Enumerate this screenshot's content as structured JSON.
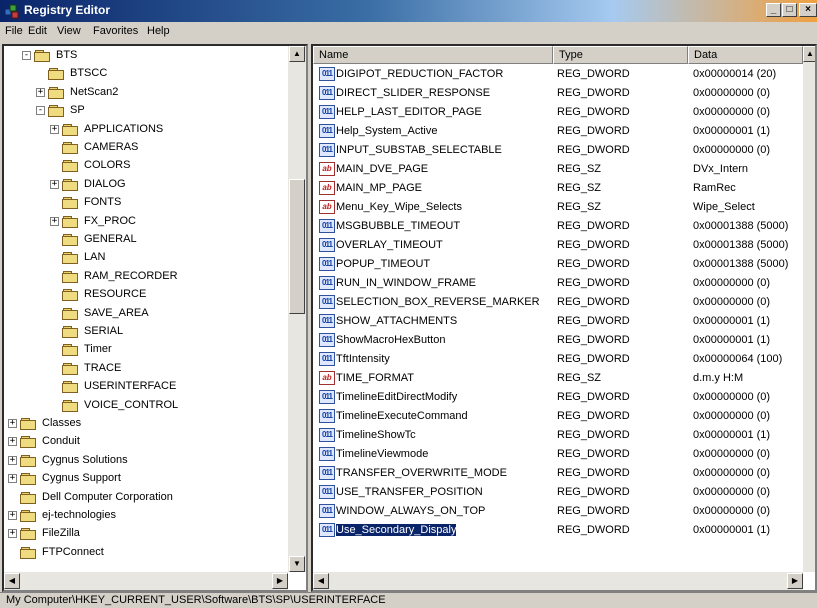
{
  "window": {
    "title": "Registry Editor",
    "minimize": "_",
    "maximize": "□",
    "close": "×",
    "colors": {
      "title_start": "#0a246a",
      "selection": "#0a246a",
      "face": "#d4d0c8"
    }
  },
  "menu": [
    "File",
    "Edit",
    "View",
    "Favorites",
    "Help"
  ],
  "tree": [
    {
      "label": "BTS",
      "level": 1,
      "expander": "-",
      "open": true
    },
    {
      "label": "BTSCC",
      "level": 2,
      "expander": ""
    },
    {
      "label": "NetScan2",
      "level": 2,
      "expander": "+"
    },
    {
      "label": "SP",
      "level": 2,
      "expander": "-",
      "open": true
    },
    {
      "label": "APPLICATIONS",
      "level": 3,
      "expander": "+"
    },
    {
      "label": "CAMERAS",
      "level": 3,
      "expander": ""
    },
    {
      "label": "COLORS",
      "level": 3,
      "expander": ""
    },
    {
      "label": "DIALOG",
      "level": 3,
      "expander": "+"
    },
    {
      "label": "FONTS",
      "level": 3,
      "expander": ""
    },
    {
      "label": "FX_PROC",
      "level": 3,
      "expander": "+"
    },
    {
      "label": "GENERAL",
      "level": 3,
      "expander": ""
    },
    {
      "label": "LAN",
      "level": 3,
      "expander": ""
    },
    {
      "label": "RAM_RECORDER",
      "level": 3,
      "expander": ""
    },
    {
      "label": "RESOURCE",
      "level": 3,
      "expander": ""
    },
    {
      "label": "SAVE_AREA",
      "level": 3,
      "expander": ""
    },
    {
      "label": "SERIAL",
      "level": 3,
      "expander": ""
    },
    {
      "label": "Timer",
      "level": 3,
      "expander": ""
    },
    {
      "label": "TRACE",
      "level": 3,
      "expander": ""
    },
    {
      "label": "USERINTERFACE",
      "level": 3,
      "expander": "",
      "selected": true
    },
    {
      "label": "VOICE_CONTROL",
      "level": 3,
      "expander": ""
    },
    {
      "label": "Classes",
      "level": 0,
      "expander": "+"
    },
    {
      "label": "Conduit",
      "level": 0,
      "expander": "+"
    },
    {
      "label": "Cygnus Solutions",
      "level": 0,
      "expander": "+"
    },
    {
      "label": "Cygnus Support",
      "level": 0,
      "expander": "+"
    },
    {
      "label": "Dell Computer Corporation",
      "level": 0,
      "expander": ""
    },
    {
      "label": "ej-technologies",
      "level": 0,
      "expander": "+"
    },
    {
      "label": "FileZilla",
      "level": 0,
      "expander": "+"
    },
    {
      "label": "FTPConnect",
      "level": 0,
      "expander": ""
    }
  ],
  "list": {
    "headers": [
      "Name",
      "Type",
      "Data"
    ],
    "rows": [
      {
        "name": "DIGIPOT_REDUCTION_FACTOR",
        "type": "REG_DWORD",
        "data": "0x00000014 (20)",
        "icon": "dword"
      },
      {
        "name": "DIRECT_SLIDER_RESPONSE",
        "type": "REG_DWORD",
        "data": "0x00000000 (0)",
        "icon": "dword"
      },
      {
        "name": "HELP_LAST_EDITOR_PAGE",
        "type": "REG_DWORD",
        "data": "0x00000000 (0)",
        "icon": "dword"
      },
      {
        "name": "Help_System_Active",
        "type": "REG_DWORD",
        "data": "0x00000001 (1)",
        "icon": "dword"
      },
      {
        "name": "INPUT_SUBSTAB_SELECTABLE",
        "type": "REG_DWORD",
        "data": "0x00000000 (0)",
        "icon": "dword"
      },
      {
        "name": "MAIN_DVE_PAGE",
        "type": "REG_SZ",
        "data": "DVx_Intern",
        "icon": "sz"
      },
      {
        "name": "MAIN_MP_PAGE",
        "type": "REG_SZ",
        "data": "RamRec",
        "icon": "sz"
      },
      {
        "name": "Menu_Key_Wipe_Selects",
        "type": "REG_SZ",
        "data": "Wipe_Select",
        "icon": "sz"
      },
      {
        "name": "MSGBUBBLE_TIMEOUT",
        "type": "REG_DWORD",
        "data": "0x00001388 (5000)",
        "icon": "dword"
      },
      {
        "name": "OVERLAY_TIMEOUT",
        "type": "REG_DWORD",
        "data": "0x00001388 (5000)",
        "icon": "dword"
      },
      {
        "name": "POPUP_TIMEOUT",
        "type": "REG_DWORD",
        "data": "0x00001388 (5000)",
        "icon": "dword"
      },
      {
        "name": "RUN_IN_WINDOW_FRAME",
        "type": "REG_DWORD",
        "data": "0x00000000 (0)",
        "icon": "dword"
      },
      {
        "name": "SELECTION_BOX_REVERSE_MARKER",
        "type": "REG_DWORD",
        "data": "0x00000000 (0)",
        "icon": "dword"
      },
      {
        "name": "SHOW_ATTACHMENTS",
        "type": "REG_DWORD",
        "data": "0x00000001 (1)",
        "icon": "dword"
      },
      {
        "name": "ShowMacroHexButton",
        "type": "REG_DWORD",
        "data": "0x00000001 (1)",
        "icon": "dword"
      },
      {
        "name": "TftIntensity",
        "type": "REG_DWORD",
        "data": "0x00000064 (100)",
        "icon": "dword"
      },
      {
        "name": "TIME_FORMAT",
        "type": "REG_SZ",
        "data": "d.m.y H:M",
        "icon": "sz"
      },
      {
        "name": "TimelineEditDirectModify",
        "type": "REG_DWORD",
        "data": "0x00000000 (0)",
        "icon": "dword"
      },
      {
        "name": "TimelineExecuteCommand",
        "type": "REG_DWORD",
        "data": "0x00000000 (0)",
        "icon": "dword"
      },
      {
        "name": "TimelineShowTc",
        "type": "REG_DWORD",
        "data": "0x00000001 (1)",
        "icon": "dword"
      },
      {
        "name": "TimelineViewmode",
        "type": "REG_DWORD",
        "data": "0x00000000 (0)",
        "icon": "dword"
      },
      {
        "name": "TRANSFER_OVERWRITE_MODE",
        "type": "REG_DWORD",
        "data": "0x00000000 (0)",
        "icon": "dword"
      },
      {
        "name": "USE_TRANSFER_POSITION",
        "type": "REG_DWORD",
        "data": "0x00000000 (0)",
        "icon": "dword"
      },
      {
        "name": "WINDOW_ALWAYS_ON_TOP",
        "type": "REG_DWORD",
        "data": "0x00000000 (0)",
        "icon": "dword"
      },
      {
        "name": "Use_Secondary_Dispaly",
        "type": "REG_DWORD",
        "data": "0x00000001 (1)",
        "icon": "dword",
        "selected": true
      }
    ]
  },
  "status": "My Computer\\HKEY_CURRENT_USER\\Software\\BTS\\SP\\USERINTERFACE"
}
